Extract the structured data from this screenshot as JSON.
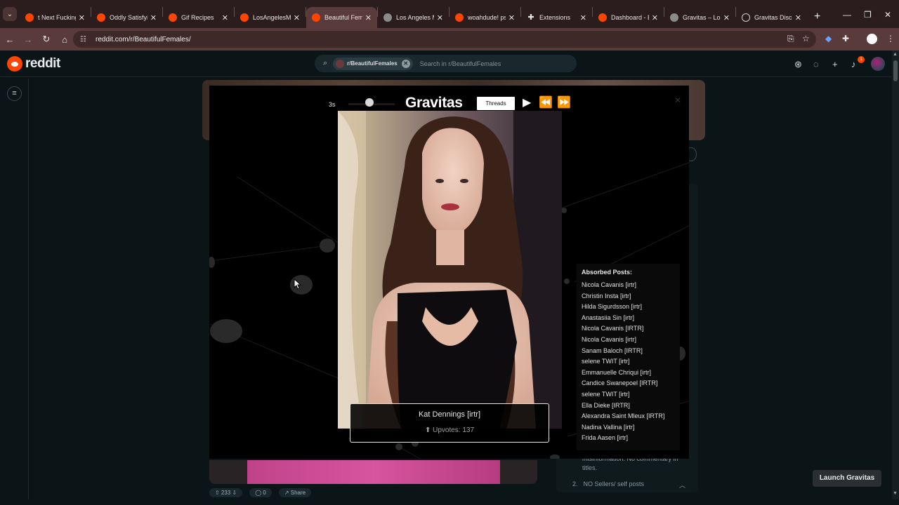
{
  "browser": {
    "tabs": [
      {
        "title": "t Next Fucking",
        "icon": "reddit-icon"
      },
      {
        "title": "Oddly Satisfying",
        "icon": "reddit-icon"
      },
      {
        "title": "Gif Recipes",
        "icon": "reddit-icon"
      },
      {
        "title": "LosAngelesMe",
        "icon": "reddit-icon"
      },
      {
        "title": "Beautiful Fema",
        "icon": "reddit-icon",
        "active": true
      },
      {
        "title": "Los Angeles M",
        "icon": "gravitas-icon"
      },
      {
        "title": "woahdude! psy",
        "icon": "reddit-icon"
      },
      {
        "title": "Extensions",
        "icon": "puzzle-icon"
      },
      {
        "title": "Dashboard - B",
        "icon": "reddit-icon"
      },
      {
        "title": "Gravitas – Los",
        "icon": "gravitas-icon"
      },
      {
        "title": "Gravitas Disco",
        "icon": "globe-icon"
      }
    ],
    "url": "reddit.com/r/BeautifulFemales/",
    "tab_close_glyph": "✕"
  },
  "reddit": {
    "logo_text": "reddit",
    "search_chip": "r/BeautifulFemales",
    "search_placeholder": "Search in r/BeautifulFemales",
    "notification_count": "1",
    "rule_text": "misinformation. No commentary in titles.",
    "rule2_number": "2.",
    "rule2_text": "NO Sellers/ self posts",
    "post_actions": [
      "⇧ 233 ⇩",
      "◯ 0",
      "↗ Share"
    ],
    "launch_label": "Launch Gravitas"
  },
  "gravitas": {
    "speed": "3s",
    "slider_value": 0.45,
    "title": "Gravitas",
    "threads_label": "Threads",
    "close_glyph": "✕",
    "caption_name": "Kat Dennings [irtr]",
    "caption_votes": "⬆ Upvotes: 137",
    "absorbed_header": "Absorbed Posts:",
    "absorbed": [
      "Nicola Cavanis [irtr]",
      "Christin Insta [irtr]",
      "Hilda Sigurdsson [irtr]",
      "Anastasiia Sin [irtr]",
      "Nicola Cavanis [IRTR]",
      "Nicola Cavanis [irtr]",
      "Sanam Baloch [IRTR]",
      "selene TWIT [irtr]",
      "Emmanuelle Chriqui [irtr]",
      "Candice Swanepoel [IRTR]",
      "selene TWIT [irtr]",
      "Ella Dieke [IRTR]",
      "Alexandra Saint Mleux [IRTR]",
      "Nadina Vallina [irtr]",
      "Frida Aasen [irtr]"
    ]
  },
  "colors": {
    "reddit_orange": "#ff4500",
    "page_bg": "#0b1416",
    "browser_frame": "#5a3b3b"
  }
}
